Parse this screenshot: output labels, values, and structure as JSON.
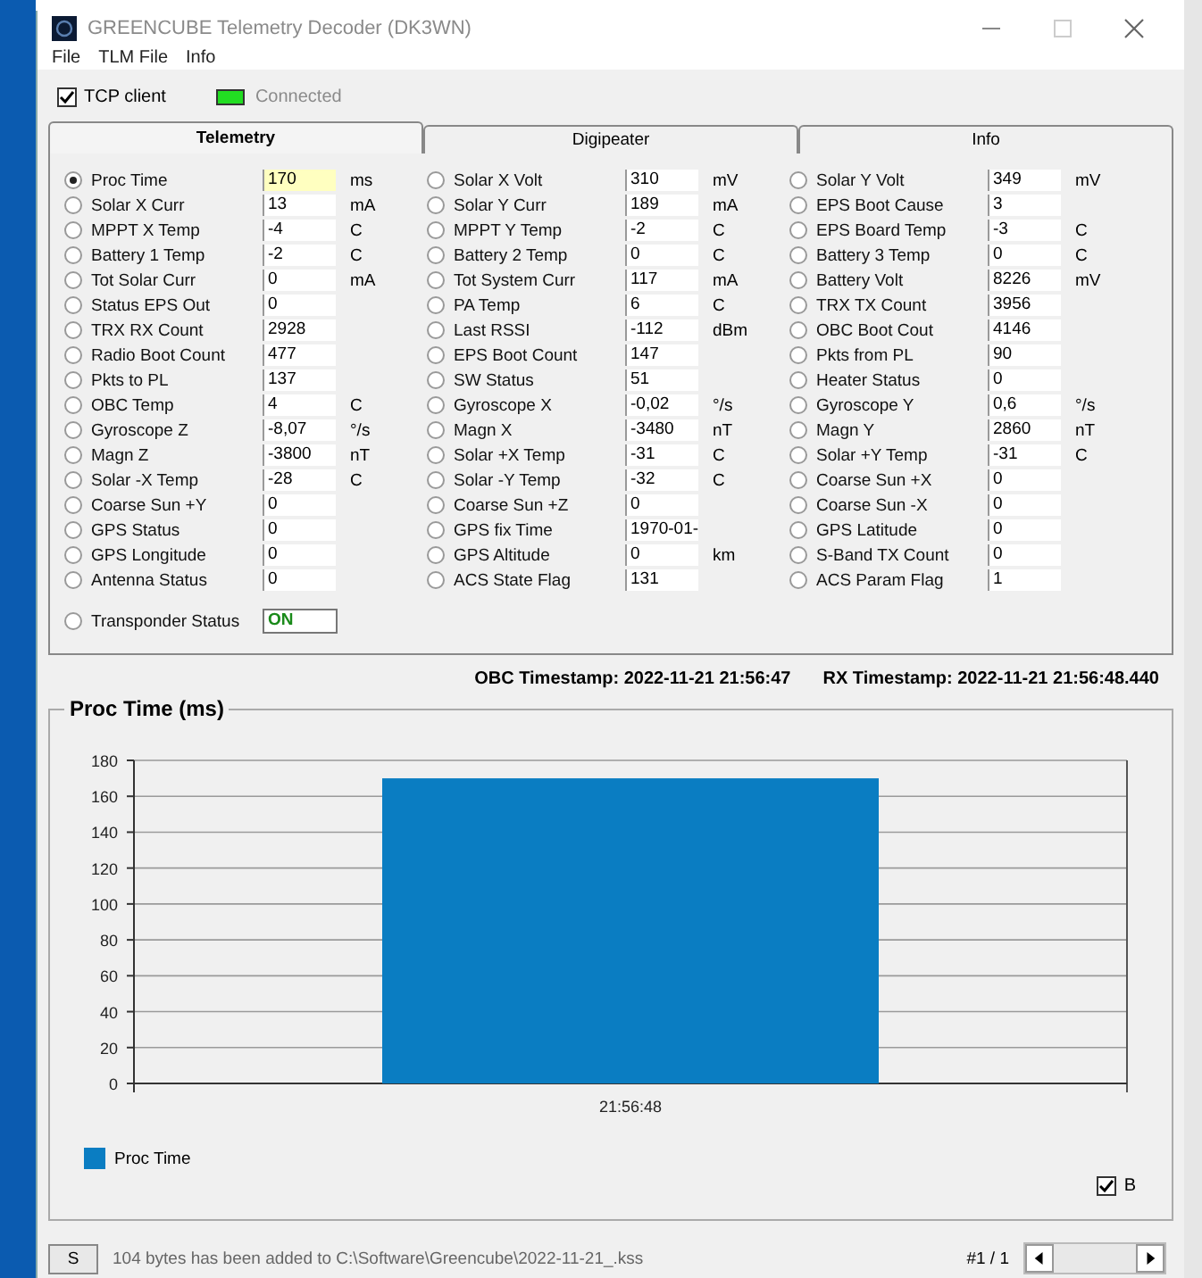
{
  "window": {
    "title": "GREENCUBE Telemetry Decoder (DK3WN)"
  },
  "menu": [
    "File",
    "TLM File",
    "Info"
  ],
  "tcp_client": {
    "label": "TCP client",
    "checked": true
  },
  "connection": {
    "label": "Connected",
    "on": true
  },
  "tabs": [
    {
      "label": "Telemetry",
      "selected": true
    },
    {
      "label": "Digipeater",
      "selected": false
    },
    {
      "label": "Info",
      "selected": false
    }
  ],
  "columns": [
    [
      {
        "label": "Proc Time",
        "value": "170",
        "unit": "ms",
        "selected": true
      },
      {
        "label": "Solar X Curr",
        "value": "13",
        "unit": "mA",
        "selected": false
      },
      {
        "label": "MPPT X Temp",
        "value": "-4",
        "unit": "C",
        "selected": false
      },
      {
        "label": "Battery 1 Temp",
        "value": "-2",
        "unit": "C",
        "selected": false
      },
      {
        "label": "Tot Solar Curr",
        "value": "0",
        "unit": "mA",
        "selected": false
      },
      {
        "label": "Status EPS Out",
        "value": "0",
        "selected": false
      },
      {
        "label": "TRX RX Count",
        "value": "2928",
        "selected": false
      },
      {
        "label": "Radio Boot Count",
        "value": "477",
        "selected": false
      },
      {
        "label": "Pkts to PL",
        "value": "137",
        "selected": false
      },
      {
        "label": "OBC Temp",
        "value": "4",
        "unit": "C",
        "selected": false
      },
      {
        "label": "Gyroscope Z",
        "value": "-8,07",
        "unit": "°/s",
        "selected": false
      },
      {
        "label": "Magn Z",
        "value": "-3800",
        "unit": "nT",
        "selected": false
      },
      {
        "label": "Solar -X Temp",
        "value": "-28",
        "unit": "C",
        "selected": false
      },
      {
        "label": "Coarse Sun +Y",
        "value": "0",
        "selected": false
      },
      {
        "label": "GPS Status",
        "value": "0",
        "selected": false
      },
      {
        "label": "GPS Longitude",
        "value": "0",
        "selected": false
      },
      {
        "label": "Antenna Status",
        "value": "0",
        "selected": false
      }
    ],
    [
      {
        "label": "Solar X Volt",
        "value": "310",
        "unit": "mV",
        "selected": false
      },
      {
        "label": "Solar Y Curr",
        "value": "189",
        "unit": "mA",
        "selected": false
      },
      {
        "label": "MPPT Y Temp",
        "value": "-2",
        "unit": "C",
        "selected": false
      },
      {
        "label": "Battery 2 Temp",
        "value": "0",
        "unit": "C",
        "selected": false
      },
      {
        "label": "Tot System Curr",
        "value": "117",
        "unit": "mA",
        "selected": false
      },
      {
        "label": "PA Temp",
        "value": "6",
        "unit": "C",
        "selected": false
      },
      {
        "label": "Last RSSI",
        "value": "-112",
        "unit": "dBm",
        "selected": false
      },
      {
        "label": "EPS Boot Count",
        "value": "147",
        "selected": false
      },
      {
        "label": "SW Status",
        "value": "51",
        "selected": false
      },
      {
        "label": "Gyroscope X",
        "value": "-0,02",
        "unit": "°/s",
        "selected": false
      },
      {
        "label": "Magn X",
        "value": "-3480",
        "unit": "nT",
        "selected": false
      },
      {
        "label": "Solar +X Temp",
        "value": "-31",
        "unit": "C",
        "selected": false
      },
      {
        "label": "Solar -Y Temp",
        "value": "-32",
        "unit": "C",
        "selected": false
      },
      {
        "label": "Coarse Sun +Z",
        "value": "0",
        "selected": false
      },
      {
        "label": "GPS fix Time",
        "value": "1970-01-",
        "selected": false
      },
      {
        "label": "GPS Altitude",
        "value": "0",
        "unit": "km",
        "selected": false
      },
      {
        "label": "ACS State Flag",
        "value": "131",
        "selected": false
      }
    ],
    [
      {
        "label": "Solar Y Volt",
        "value": "349",
        "unit": "mV",
        "selected": false
      },
      {
        "label": "EPS Boot Cause",
        "value": "3",
        "selected": false
      },
      {
        "label": "EPS Board Temp",
        "value": "-3",
        "unit": "C",
        "selected": false
      },
      {
        "label": "Battery 3 Temp",
        "value": "0",
        "unit": "C",
        "selected": false
      },
      {
        "label": "Battery Volt",
        "value": "8226",
        "unit": "mV",
        "selected": false
      },
      {
        "label": "TRX TX Count",
        "value": "3956",
        "selected": false
      },
      {
        "label": "OBC Boot Cout",
        "value": "4146",
        "selected": false
      },
      {
        "label": "Pkts from PL",
        "value": "90",
        "selected": false
      },
      {
        "label": "Heater Status",
        "value": "0",
        "selected": false
      },
      {
        "label": "Gyroscope Y",
        "value": "0,6",
        "unit": "°/s",
        "selected": false
      },
      {
        "label": "Magn Y",
        "value": "2860",
        "unit": "nT",
        "selected": false
      },
      {
        "label": "Solar +Y Temp",
        "value": "-31",
        "unit": "C",
        "selected": false
      },
      {
        "label": "Coarse Sun +X",
        "value": "0",
        "selected": false
      },
      {
        "label": "Coarse Sun -X",
        "value": "0",
        "selected": false
      },
      {
        "label": "GPS Latitude",
        "value": "0",
        "selected": false
      },
      {
        "label": "S-Band TX Count",
        "value": "0",
        "selected": false
      },
      {
        "label": "ACS Param Flag",
        "value": "1",
        "selected": false
      }
    ]
  ],
  "transponder": {
    "label": "Transponder Status",
    "value": "ON",
    "selected": false
  },
  "timestamps": [
    "OBC Timestamp: 2022-11-21 21:56:47",
    "RX Timestamp: 2022-11-21 21:56:48.440"
  ],
  "chart": {
    "chart_data": {
      "type": "bar",
      "title": "Proc Time (ms)",
      "categories": [
        "21:56:48"
      ],
      "series": [
        {
          "name": "Proc Time",
          "color": "#0a7dc2",
          "values": [
            170
          ]
        }
      ],
      "ylim": [
        0,
        180
      ],
      "yticks": [
        0,
        20,
        40,
        60,
        80,
        100,
        120,
        140,
        160,
        180
      ],
      "grid": true
    },
    "b_checkbox": {
      "label": "B",
      "checked": true
    }
  },
  "status_bar": {
    "button": "S",
    "message": "104 bytes has been added to C:\\Software\\Greencube\\2022-11-21_.kss",
    "record": "#1 / 1"
  }
}
